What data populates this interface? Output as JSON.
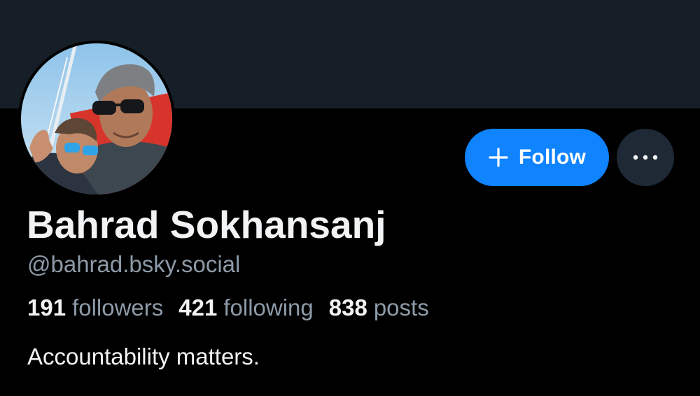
{
  "colors": {
    "background": "#000000",
    "banner": "#161e27",
    "accent": "#1083fe",
    "secondary_button": "#1e2935",
    "muted_text": "#8d9aa8",
    "primary_text": "#f1f3f5"
  },
  "profile": {
    "display_name": "Bahrad Sokhansanj",
    "handle": "@bahrad.bsky.social",
    "bio": "Accountability matters.",
    "avatar_icon": "profile-photo"
  },
  "stats": [
    {
      "value": "191",
      "label": "followers"
    },
    {
      "value": "421",
      "label": "following"
    },
    {
      "value": "838",
      "label": "posts"
    }
  ],
  "actions": {
    "follow_label": "Follow",
    "follow_icon": "plus-icon",
    "more_icon": "ellipsis-icon"
  }
}
